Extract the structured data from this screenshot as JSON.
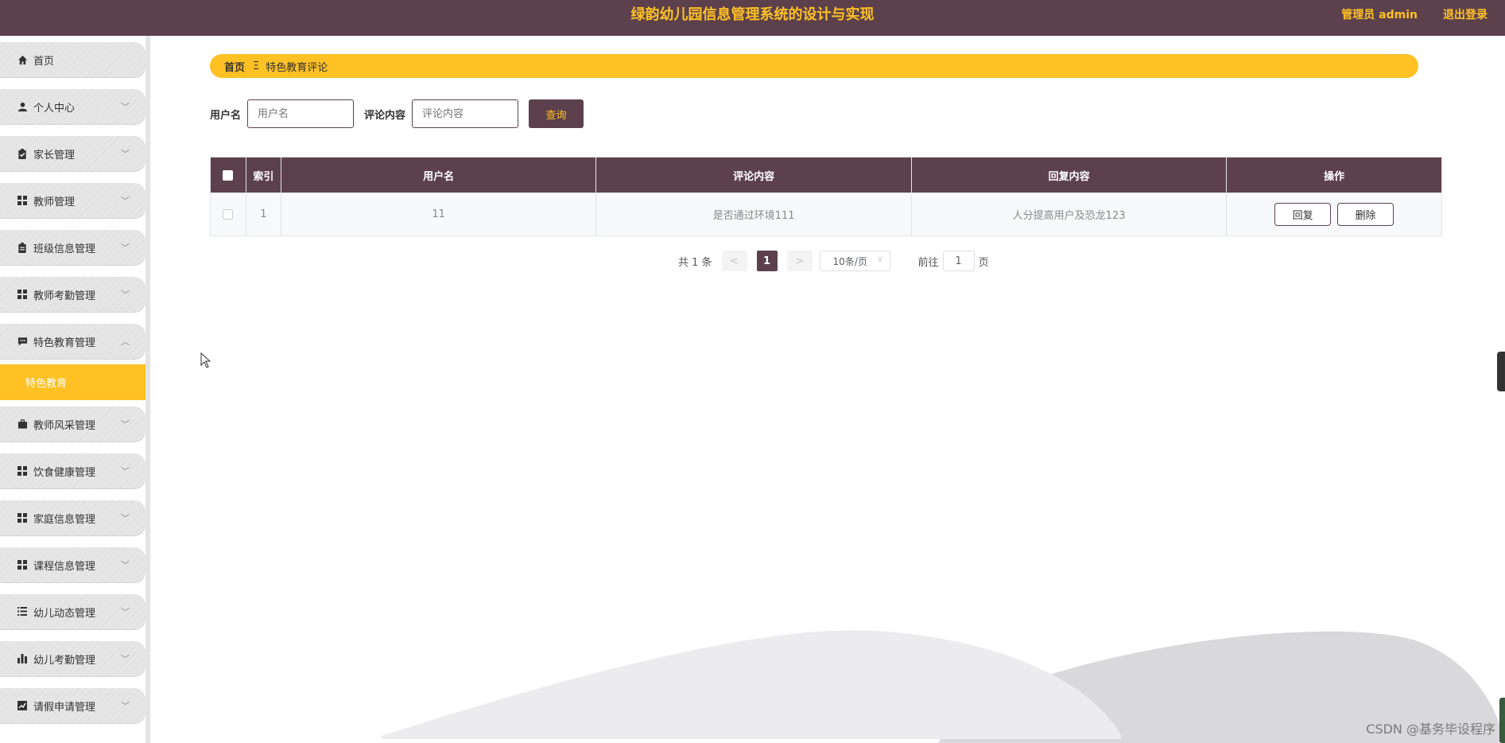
{
  "header": {
    "title": "绿韵幼儿园信息管理系统的设计与实现",
    "admin": "管理员 admin",
    "logout": "退出登录"
  },
  "sidebar": {
    "items": [
      {
        "label": "首页",
        "icon": "home-icon",
        "chevron": ""
      },
      {
        "label": "个人中心",
        "icon": "user-icon",
        "chevron": "﹀"
      },
      {
        "label": "家长管理",
        "icon": "clipboard-icon",
        "chevron": "﹀"
      },
      {
        "label": "教师管理",
        "icon": "grid-icon",
        "chevron": "﹀"
      },
      {
        "label": "班级信息管理",
        "icon": "clipboard-icon",
        "chevron": "﹀"
      },
      {
        "label": "教师考勤管理",
        "icon": "grid-icon",
        "chevron": "﹀"
      },
      {
        "label": "特色教育管理",
        "icon": "comment-icon",
        "chevron": "︿"
      },
      {
        "label": "教师风采管理",
        "icon": "briefcase-icon",
        "chevron": "﹀"
      },
      {
        "label": "饮食健康管理",
        "icon": "grid-icon",
        "chevron": "﹀"
      },
      {
        "label": "家庭信息管理",
        "icon": "grid-icon",
        "chevron": "﹀"
      },
      {
        "label": "课程信息管理",
        "icon": "grid-icon",
        "chevron": "﹀"
      },
      {
        "label": "幼儿动态管理",
        "icon": "list-icon",
        "chevron": "﹀"
      },
      {
        "label": "幼儿考勤管理",
        "icon": "bar-chart-icon",
        "chevron": "﹀"
      },
      {
        "label": "请假申请管理",
        "icon": "line-chart-icon",
        "chevron": "﹀"
      }
    ],
    "active_sub": "特色教育"
  },
  "breadcrumb": {
    "home": "首页",
    "separator": "Ξ",
    "current": "特色教育评论"
  },
  "search": {
    "username_label": "用户名",
    "username_placeholder": "用户名",
    "comment_label": "评论内容",
    "comment_placeholder": "评论内容",
    "query_button": "查询"
  },
  "table": {
    "headers": [
      "索引",
      "用户名",
      "评论内容",
      "回复内容",
      "操作"
    ],
    "rows": [
      {
        "index": "1",
        "username": "11",
        "comment": "是否通过环境111",
        "reply": "人分提高用户及恐龙123",
        "reply_btn": "回复",
        "delete_btn": "删除"
      }
    ]
  },
  "pagination": {
    "total": "共 1 条",
    "prev": "<",
    "current": "1",
    "next": ">",
    "page_size": "10条/页",
    "goto_label": "前往",
    "goto_value": "1",
    "page_unit": "页"
  },
  "watermark": "CSDN @基务毕设程序",
  "colors": {
    "primary": "#5c414c",
    "accent": "#ffc124"
  }
}
